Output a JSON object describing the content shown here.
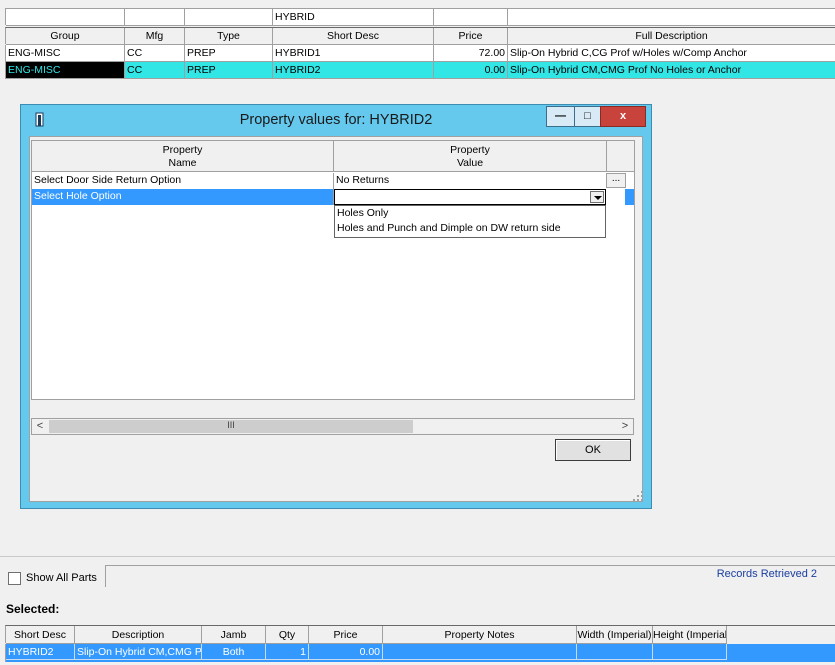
{
  "parts_grid": {
    "filter_row": {
      "short_desc": "HYBRID"
    },
    "columns": [
      "Group",
      "Mfg",
      "Type",
      "Short Desc",
      "Price",
      "Full Description"
    ],
    "rows": [
      {
        "group": "ENG-MISC",
        "mfg": "CC",
        "type": "PREP",
        "short_desc": "HYBRID1",
        "price": "72.00",
        "full_desc": "Slip-On Hybrid C,CG Prof w/Holes w/Comp Anchor"
      },
      {
        "group": "ENG-MISC",
        "mfg": "CC",
        "type": "PREP",
        "short_desc": "HYBRID2",
        "price": "0.00",
        "full_desc": "Slip-On Hybrid CM,CMG Prof No Holes or Anchor"
      }
    ]
  },
  "dialog": {
    "title": "Property values for: HYBRID2",
    "min_glyph": "—",
    "max_glyph": "□",
    "close_glyph": "x",
    "columns": {
      "name_line1": "Property",
      "name_line2": "Name",
      "value_line1": "Property",
      "value_line2": "Value"
    },
    "rows": [
      {
        "name": "Select Door Side Return Option",
        "value": "No Returns"
      },
      {
        "name": "Select Hole Option",
        "value": ""
      }
    ],
    "ellipsis": "...",
    "dropdown_options": [
      "Holes Only",
      "Holes and Punch and Dimple on DW return side"
    ],
    "scroll_left": "<",
    "scroll_right": ">",
    "scroll_thumb": "III",
    "ok_label": "OK"
  },
  "footer": {
    "show_all_parts": "Show All Parts",
    "records_retrieved": "Records Retrieved 2",
    "selected_label": "Selected:"
  },
  "selected_grid": {
    "columns": [
      "Short Desc",
      "Description",
      "Jamb",
      "Qty",
      "Price",
      "Property Notes",
      "Width (Imperial)",
      "Height (Imperial)"
    ],
    "rows": [
      {
        "short_desc": "HYBRID2",
        "description": "Slip-On Hybrid CM,CMG P",
        "jamb": "Both",
        "qty": "1",
        "price": "0.00",
        "notes": "",
        "width": "",
        "height": ""
      }
    ]
  },
  "colors": {
    "selected_row": "#33e6e6",
    "highlight": "#3399ff",
    "dialog_frame": "#65c9ee",
    "close": "#c7433c"
  }
}
